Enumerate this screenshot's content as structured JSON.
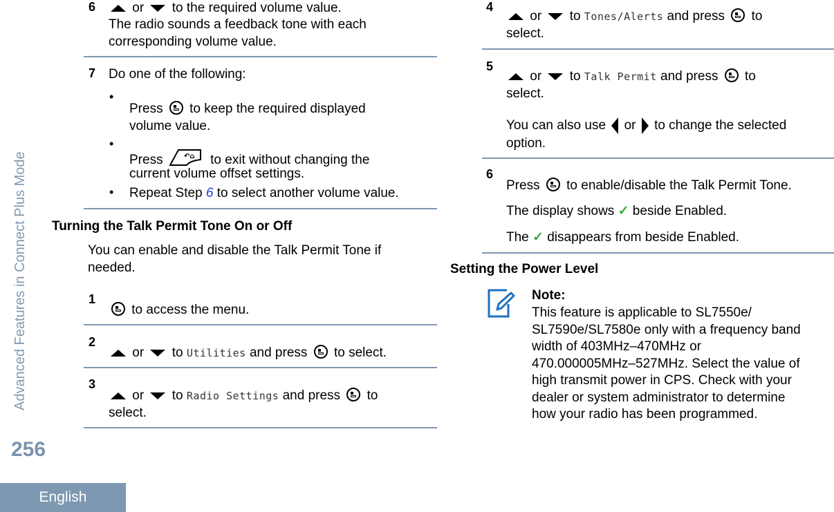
{
  "sidebar": {
    "section_title": "Advanced Features in Connect Plus Mode",
    "page_number": "256",
    "language": "English"
  },
  "left": {
    "step6": {
      "num": "6",
      "or": "or",
      "text1": "to the required volume value.",
      "text2": "The radio sounds a feedback tone with each",
      "text3": "corresponding volume value."
    },
    "step7": {
      "num": "7",
      "intro": "Do one of the following:",
      "bullet": "•",
      "b1_press": "Press",
      "b1_text": "to keep the required displayed",
      "b1_text2": "volume value.",
      "b2_press": "Press",
      "b2_text": "to exit without changing the",
      "b2_text2": "current volume offset settings.",
      "b3_pre": "Repeat Step",
      "b3_link": "6",
      "b3_post": "to select another volume value."
    },
    "section": {
      "heading": "Turning the Talk Permit Tone On or Off",
      "intro1": "You can enable and disable the Talk Permit Tone if",
      "intro2": "needed."
    },
    "s1": {
      "num": "1",
      "text": "to access the menu."
    },
    "s2": {
      "num": "2",
      "or": "or",
      "to": "to",
      "menu": "Utilities",
      "press": "and press",
      "post": "to select."
    },
    "s3": {
      "num": "3",
      "or": "or",
      "to": "to",
      "menu": "Radio Settings",
      "press": "and press",
      "post": "to",
      "post2": "select."
    }
  },
  "right": {
    "s4": {
      "num": "4",
      "or": "or",
      "to": "to",
      "menu": "Tones/Alerts",
      "press": "and press",
      "post": "to",
      "post2": "select."
    },
    "s5": {
      "num": "5",
      "or": "or",
      "to": "to",
      "menu": "Talk Permit",
      "press": "and press",
      "post": "to",
      "post2": "select.",
      "also1": "You can also use",
      "also_or": "or",
      "also2": "to change the selected",
      "also3": "option."
    },
    "s6": {
      "num": "6",
      "press": "Press",
      "text": "to enable/disable the Talk Permit Tone.",
      "r1a": "The display shows",
      "r1b": "beside Enabled.",
      "r2a": "The",
      "r2b": "disappears from beside Enabled.",
      "check": "✓"
    },
    "section": {
      "heading": "Setting the Power Level"
    },
    "note": {
      "label": "Note:",
      "lines": [
        "This feature is applicable to SL7550e/",
        "SL7590e/SL7580e only with a frequency band",
        "width of 403MHz–470MHz or",
        "470.000005MHz–527MHz. Select the value of",
        "high transmit power in CPS. Check with your",
        "dealer or system administrator to determine",
        "how your radio has been programmed."
      ]
    }
  }
}
